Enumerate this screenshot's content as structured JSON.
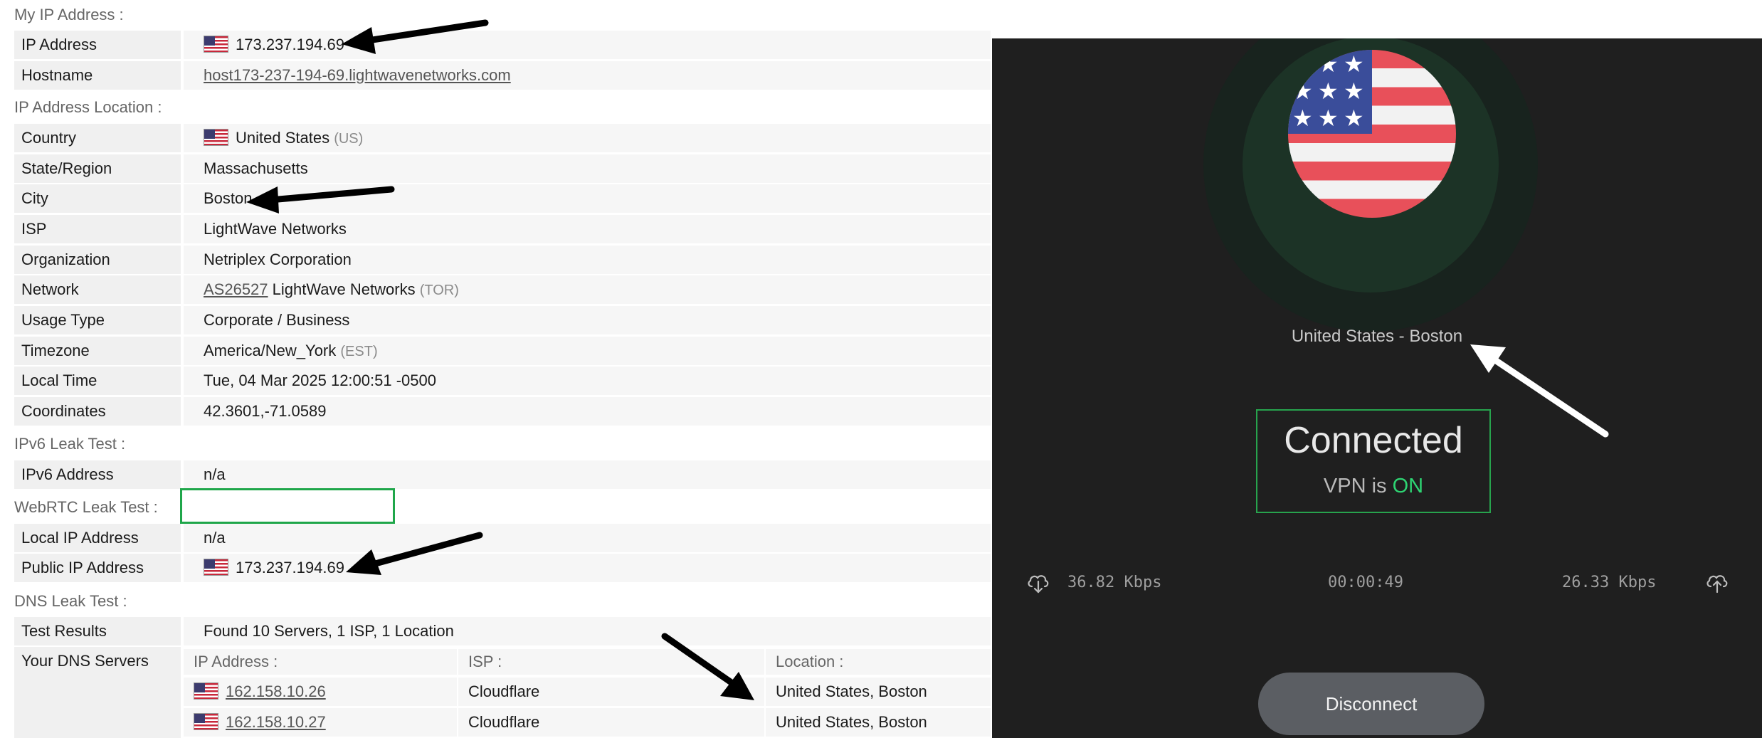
{
  "sections": {
    "my_ip": "My IP Address :",
    "location": "IP Address Location :",
    "ipv6": "IPv6 Leak Test :",
    "webrtc": "WebRTC Leak Test :",
    "dns": "DNS Leak Test :"
  },
  "my_ip": {
    "ip_label": "IP Address",
    "ip_value": "173.237.194.69",
    "hostname_label": "Hostname",
    "hostname_value": "host173-237-194-69.lightwavenetworks.com"
  },
  "location": {
    "country_label": "Country",
    "country_value": "United States",
    "country_code": "(US)",
    "state_label": "State/Region",
    "state_value": "Massachusetts",
    "city_label": "City",
    "city_value": "Boston",
    "isp_label": "ISP",
    "isp_value": "LightWave Networks",
    "org_label": "Organization",
    "org_value": "Netriplex Corporation",
    "network_label": "Network",
    "network_asn": "AS26527",
    "network_name": "LightWave Networks",
    "network_code": "(TOR)",
    "usage_label": "Usage Type",
    "usage_value": "Corporate / Business",
    "tz_label": "Timezone",
    "tz_value": "America/New_York",
    "tz_code": "(EST)",
    "time_label": "Local Time",
    "time_value": "Tue, 04 Mar 2025 12:00:51 -0500",
    "coord_label": "Coordinates",
    "coord_value": "42.3601,-71.0589"
  },
  "ipv6": {
    "addr_label": "IPv6 Address",
    "addr_value": "n/a"
  },
  "webrtc": {
    "local_label": "Local IP Address",
    "local_value": "n/a",
    "public_label": "Public IP Address",
    "public_value": "173.237.194.69"
  },
  "dns": {
    "results_label": "Test Results",
    "results_value": "Found 10 Servers, 1 ISP, 1 Location",
    "servers_label": "Your DNS Servers",
    "col_ip": "IP Address :",
    "col_isp": "ISP :",
    "col_loc": "Location :",
    "rows": [
      {
        "ip": "162.158.10.26",
        "isp": "Cloudflare",
        "location": "United States, Boston"
      },
      {
        "ip": "162.158.10.27",
        "isp": "Cloudflare",
        "location": "United States, Boston"
      }
    ]
  },
  "vpn": {
    "location": "United States - Boston",
    "status_title": "Connected",
    "status_prefix": "VPN is",
    "status_on": "ON",
    "download": "36.82 Kbps",
    "timer": "00:00:49",
    "upload": "26.33 Kbps",
    "disconnect_label": "Disconnect"
  },
  "colors": {
    "connected_green": "#2ed573",
    "box_green": "#27a34d",
    "webrtc_box": "#1fa64a",
    "vpn_bg": "#1f1f1f"
  },
  "icons": {
    "download": "download-cloud-icon",
    "upload": "upload-cloud-icon",
    "flag": "us-flag-icon",
    "arrow": "black-arrow-icon"
  }
}
